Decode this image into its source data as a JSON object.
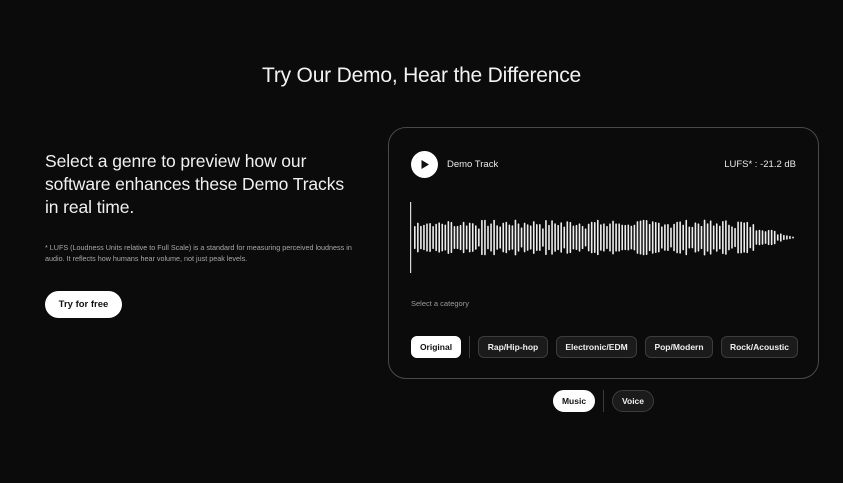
{
  "headline": "Try Our Demo, Hear the Difference",
  "intro": {
    "text": "Select a genre to preview how our software enhances these Demo Tracks in real time.",
    "footnote": "* LUFS (Loudness Units relative to Full Scale) is a standard for measuring perceived loudness in audio. It reflects how humans hear volume, not just peak levels.",
    "cta_label": "Try for free"
  },
  "player": {
    "track_name": "Demo Track",
    "lufs": "LUFS* : -21.2 dB",
    "play_icon": "play-icon",
    "select_label": "Select a category",
    "categories": [
      {
        "label": "Original",
        "active": true
      },
      {
        "label": "Rap/Hip-hop",
        "active": false
      },
      {
        "label": "Electronic/EDM",
        "active": false
      },
      {
        "label": "Pop/Modern",
        "active": false
      },
      {
        "label": "Rock/Acoustic",
        "active": false
      }
    ]
  },
  "modes": [
    {
      "label": "Music",
      "active": true
    },
    {
      "label": "Voice",
      "active": false
    }
  ],
  "colors": {
    "background": "#0b0b0b",
    "accent": "#ffffff",
    "chip_bg": "#1b1b1b",
    "border": "#4a4a4a"
  }
}
